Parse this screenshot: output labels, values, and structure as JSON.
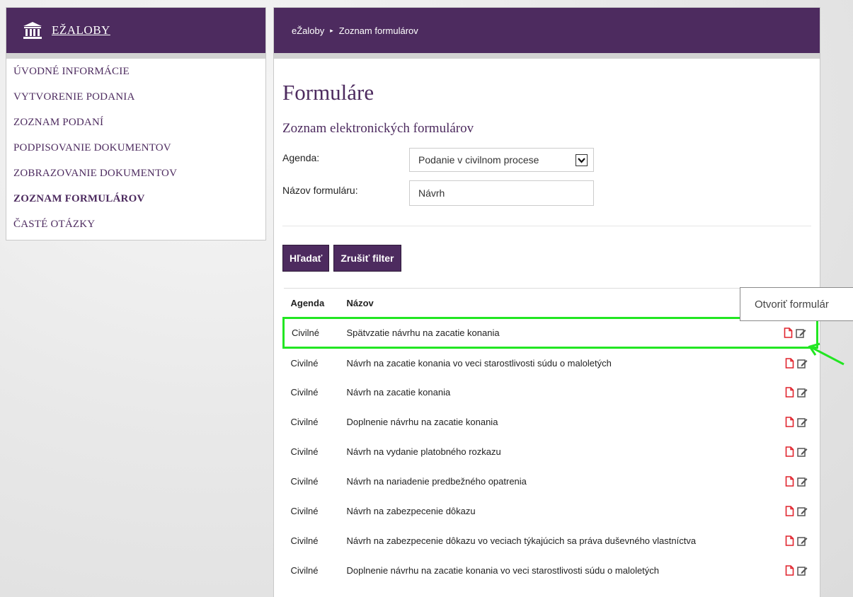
{
  "sidebar": {
    "logo_text": "EŽALOBY",
    "items": [
      {
        "label": "ÚVODNÉ INFORMÁCIE",
        "active": false
      },
      {
        "label": "VYTVORENIE PODANIA",
        "active": false
      },
      {
        "label": "ZOZNAM PODANÍ",
        "active": false
      },
      {
        "label": "PODPISOVANIE DOKUMENTOV",
        "active": false
      },
      {
        "label": "ZOBRAZOVANIE DOKUMENTOV",
        "active": false
      },
      {
        "label": "ZOZNAM FORMULÁROV",
        "active": true
      },
      {
        "label": "ČASTÉ OTÁZKY",
        "active": false
      }
    ]
  },
  "breadcrumb": {
    "home": "eŽaloby",
    "separator": "▸",
    "current": "Zoznam formulárov"
  },
  "page": {
    "title": "Formuláre",
    "subtitle": "Zoznam elektronických formulárov"
  },
  "filters": {
    "agenda_label": "Agenda:",
    "agenda_value": "Podanie v civilnom procese",
    "name_label": "Názov formuláru:",
    "name_value": "Návrh"
  },
  "buttons": {
    "search": "Hľadať",
    "clear": "Zrušiť filter"
  },
  "table": {
    "headers": {
      "agenda": "Agenda",
      "name": "Názov"
    },
    "rows": [
      {
        "agenda": "Civilné",
        "name": "Spätvzatie návrhu na zacatie konania"
      },
      {
        "agenda": "Civilné",
        "name": "Návrh na zacatie konania vo veci starostlivosti súdu o maloletých"
      },
      {
        "agenda": "Civilné",
        "name": "Návrh na zacatie konania"
      },
      {
        "agenda": "Civilné",
        "name": "Doplnenie návrhu na zacatie konania"
      },
      {
        "agenda": "Civilné",
        "name": "Návrh na vydanie platobného rozkazu"
      },
      {
        "agenda": "Civilné",
        "name": "Návrh na nariadenie predbežného opatrenia"
      },
      {
        "agenda": "Civilné",
        "name": "Návrh na zabezpecenie dôkazu"
      },
      {
        "agenda": "Civilné",
        "name": "Návrh na zabezpecenie dôkazu vo veciach týkajúcich sa práva duševného vlastníctva"
      },
      {
        "agenda": "Civilné",
        "name": "Doplnenie návrhu na zacatie konania vo veci starostlivosti súdu o maloletých"
      }
    ]
  },
  "tooltip": {
    "text": "Otvoriť formulár"
  },
  "icons": {
    "logo": "courthouse-icon",
    "pdf": "pdf-document-icon",
    "edit": "edit-form-icon",
    "dropdown": "chevron-down-icon"
  },
  "colors": {
    "brand": "#4d2b5f",
    "highlight": "#22e622",
    "pdf_icon": "#e0242d"
  }
}
